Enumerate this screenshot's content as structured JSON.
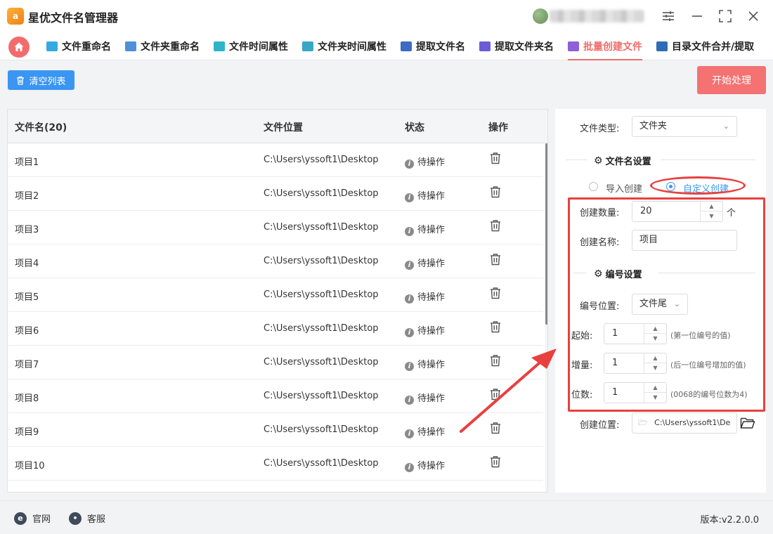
{
  "app": {
    "title": "星优文件名管理器",
    "logo_text": "a"
  },
  "window_controls": [
    "settings-icon",
    "minimize-icon",
    "maximize-icon",
    "close-icon"
  ],
  "tabs": [
    {
      "label": "文件重命名",
      "active": false,
      "icon": "file-rename-icon",
      "color": "#36a9e1"
    },
    {
      "label": "文件夹重命名",
      "active": false,
      "icon": "folder-rename-icon",
      "color": "#4e8fd8"
    },
    {
      "label": "文件时间属性",
      "active": false,
      "icon": "file-time-icon",
      "color": "#2fb3c9"
    },
    {
      "label": "文件夹时间属性",
      "active": false,
      "icon": "folder-time-icon",
      "color": "#38a7c5"
    },
    {
      "label": "提取文件名",
      "active": false,
      "icon": "extract-filename-icon",
      "color": "#3b6cc2"
    },
    {
      "label": "提取文件夹名",
      "active": false,
      "icon": "extract-foldername-icon",
      "color": "#6b5bd6"
    },
    {
      "label": "批量创建文件",
      "active": true,
      "icon": "batch-create-icon",
      "color": "#8e5fd6"
    },
    {
      "label": "目录文件合并/提取",
      "active": false,
      "icon": "merge-extract-icon",
      "color": "#2e6db4"
    }
  ],
  "toolbar": {
    "clear_label": "清空列表",
    "start_label": "开始处理"
  },
  "table": {
    "headers": {
      "name": "文件名(20)",
      "location": "文件位置",
      "status": "状态",
      "action": "操作"
    },
    "rows": [
      {
        "name": "项目1",
        "location": "C:\\Users\\yssoft1\\Desktop",
        "status": "待操作"
      },
      {
        "name": "项目2",
        "location": "C:\\Users\\yssoft1\\Desktop",
        "status": "待操作"
      },
      {
        "name": "项目3",
        "location": "C:\\Users\\yssoft1\\Desktop",
        "status": "待操作"
      },
      {
        "name": "项目4",
        "location": "C:\\Users\\yssoft1\\Desktop",
        "status": "待操作"
      },
      {
        "name": "项目5",
        "location": "C:\\Users\\yssoft1\\Desktop",
        "status": "待操作"
      },
      {
        "name": "项目6",
        "location": "C:\\Users\\yssoft1\\Desktop",
        "status": "待操作"
      },
      {
        "name": "项目7",
        "location": "C:\\Users\\yssoft1\\Desktop",
        "status": "待操作"
      },
      {
        "name": "项目8",
        "location": "C:\\Users\\yssoft1\\Desktop",
        "status": "待操作"
      },
      {
        "name": "项目9",
        "location": "C:\\Users\\yssoft1\\Desktop",
        "status": "待操作"
      },
      {
        "name": "项目10",
        "location": "C:\\Users\\yssoft1\\Desktop",
        "status": "待操作"
      }
    ]
  },
  "settings": {
    "file_type_label": "文件类型:",
    "file_type_value": "文件夹",
    "filename_section": "文件名设置",
    "radio_import": "导入创建",
    "radio_custom": "自定义创建",
    "count_label": "创建数量:",
    "count_value": "20",
    "count_unit": "个",
    "name_label": "创建名称:",
    "name_value": "项目",
    "numbering_section": "编号设置",
    "num_position_label": "编号位置:",
    "num_position_value": "文件尾",
    "start_label": "起始:",
    "start_value": "1",
    "start_hint": "(第一位编号的值)",
    "increment_label": "增量:",
    "increment_value": "1",
    "increment_hint": "(后一位编号增加的值)",
    "digits_label": "位数:",
    "digits_value": "1",
    "digits_hint": "(0068的编号位数为4)",
    "location_label": "创建位置:",
    "location_value": "C:\\Users\\yssoft1\\De"
  },
  "footer": {
    "website": "官网",
    "support": "客服",
    "version": "版本:v2.2.0.0"
  },
  "colors": {
    "accent": "#f26c6c",
    "primary": "#3a95f3",
    "highlight": "#e8403f"
  }
}
